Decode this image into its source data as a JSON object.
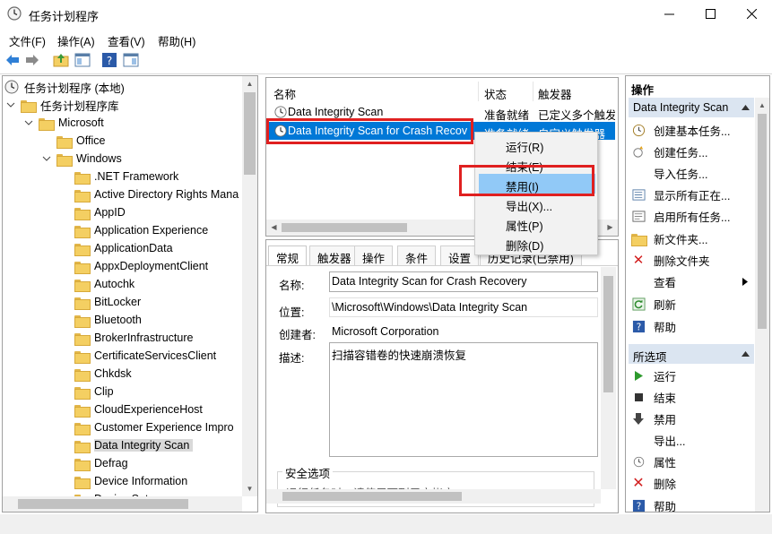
{
  "window": {
    "title": "任务计划程序"
  },
  "menu": [
    "文件(F)",
    "操作(A)",
    "查看(V)",
    "帮助(H)"
  ],
  "tree": {
    "root": "任务计划程序 (本地)",
    "library": "任务计划程序库",
    "microsoft": "Microsoft",
    "office": "Office",
    "windows": "Windows",
    "items": [
      ".NET Framework",
      "Active Directory Rights Mana",
      "AppID",
      "Application Experience",
      "ApplicationData",
      "AppxDeploymentClient",
      "Autochk",
      "BitLocker",
      "Bluetooth",
      "BrokerInfrastructure",
      "CertificateServicesClient",
      "Chkdsk",
      "Clip",
      "CloudExperienceHost",
      "Customer Experience Impro",
      "Data Integrity Scan",
      "Defrag",
      "Device Information",
      "Device Setu"
    ]
  },
  "list": {
    "columns": [
      "名称",
      "状态",
      "触发器"
    ],
    "rows": [
      {
        "name": "Data Integrity Scan",
        "status": "准备就绪",
        "trigger": "已定义多个触发"
      },
      {
        "name": "Data Integrity Scan for Crash Recov",
        "status": "准备就绪",
        "trigger": "自定义触发器"
      }
    ]
  },
  "context_menu": [
    "运行(R)",
    "结束(E)",
    "禁用(I)",
    "导出(X)...",
    "属性(P)",
    "删除(D)"
  ],
  "details": {
    "tabs": [
      "常规",
      "触发器",
      "操作",
      "条件",
      "设置",
      "历史记录(已禁用)"
    ],
    "name_label": "名称:",
    "name_value": "Data Integrity Scan for Crash Recovery",
    "location_label": "位置:",
    "location_value": "\\Microsoft\\Windows\\Data Integrity Scan",
    "author_label": "创建者:",
    "author_value": "Microsoft Corporation",
    "desc_label": "描述:",
    "desc_value": "扫描容错卷的快速崩溃恢复",
    "security_label": "安全选项",
    "security_hint": "运行任务时，请使用下列用户帐户:"
  },
  "actions": {
    "header": "操作",
    "section1": "Data Integrity Scan",
    "items1": [
      "创建基本任务...",
      "创建任务...",
      "导入任务...",
      "显示所有正在...",
      "启用所有任务...",
      "新文件夹...",
      "删除文件夹",
      "查看",
      "刷新",
      "帮助"
    ],
    "section2": "所选项",
    "items2": [
      "运行",
      "结束",
      "禁用",
      "导出...",
      "属性",
      "删除",
      "帮助"
    ]
  },
  "colors": {
    "selection": "#0078d7",
    "section_bg": "#dbe5f1",
    "highlight_box": "#e02020",
    "menu_hover": "#91c9f7"
  }
}
